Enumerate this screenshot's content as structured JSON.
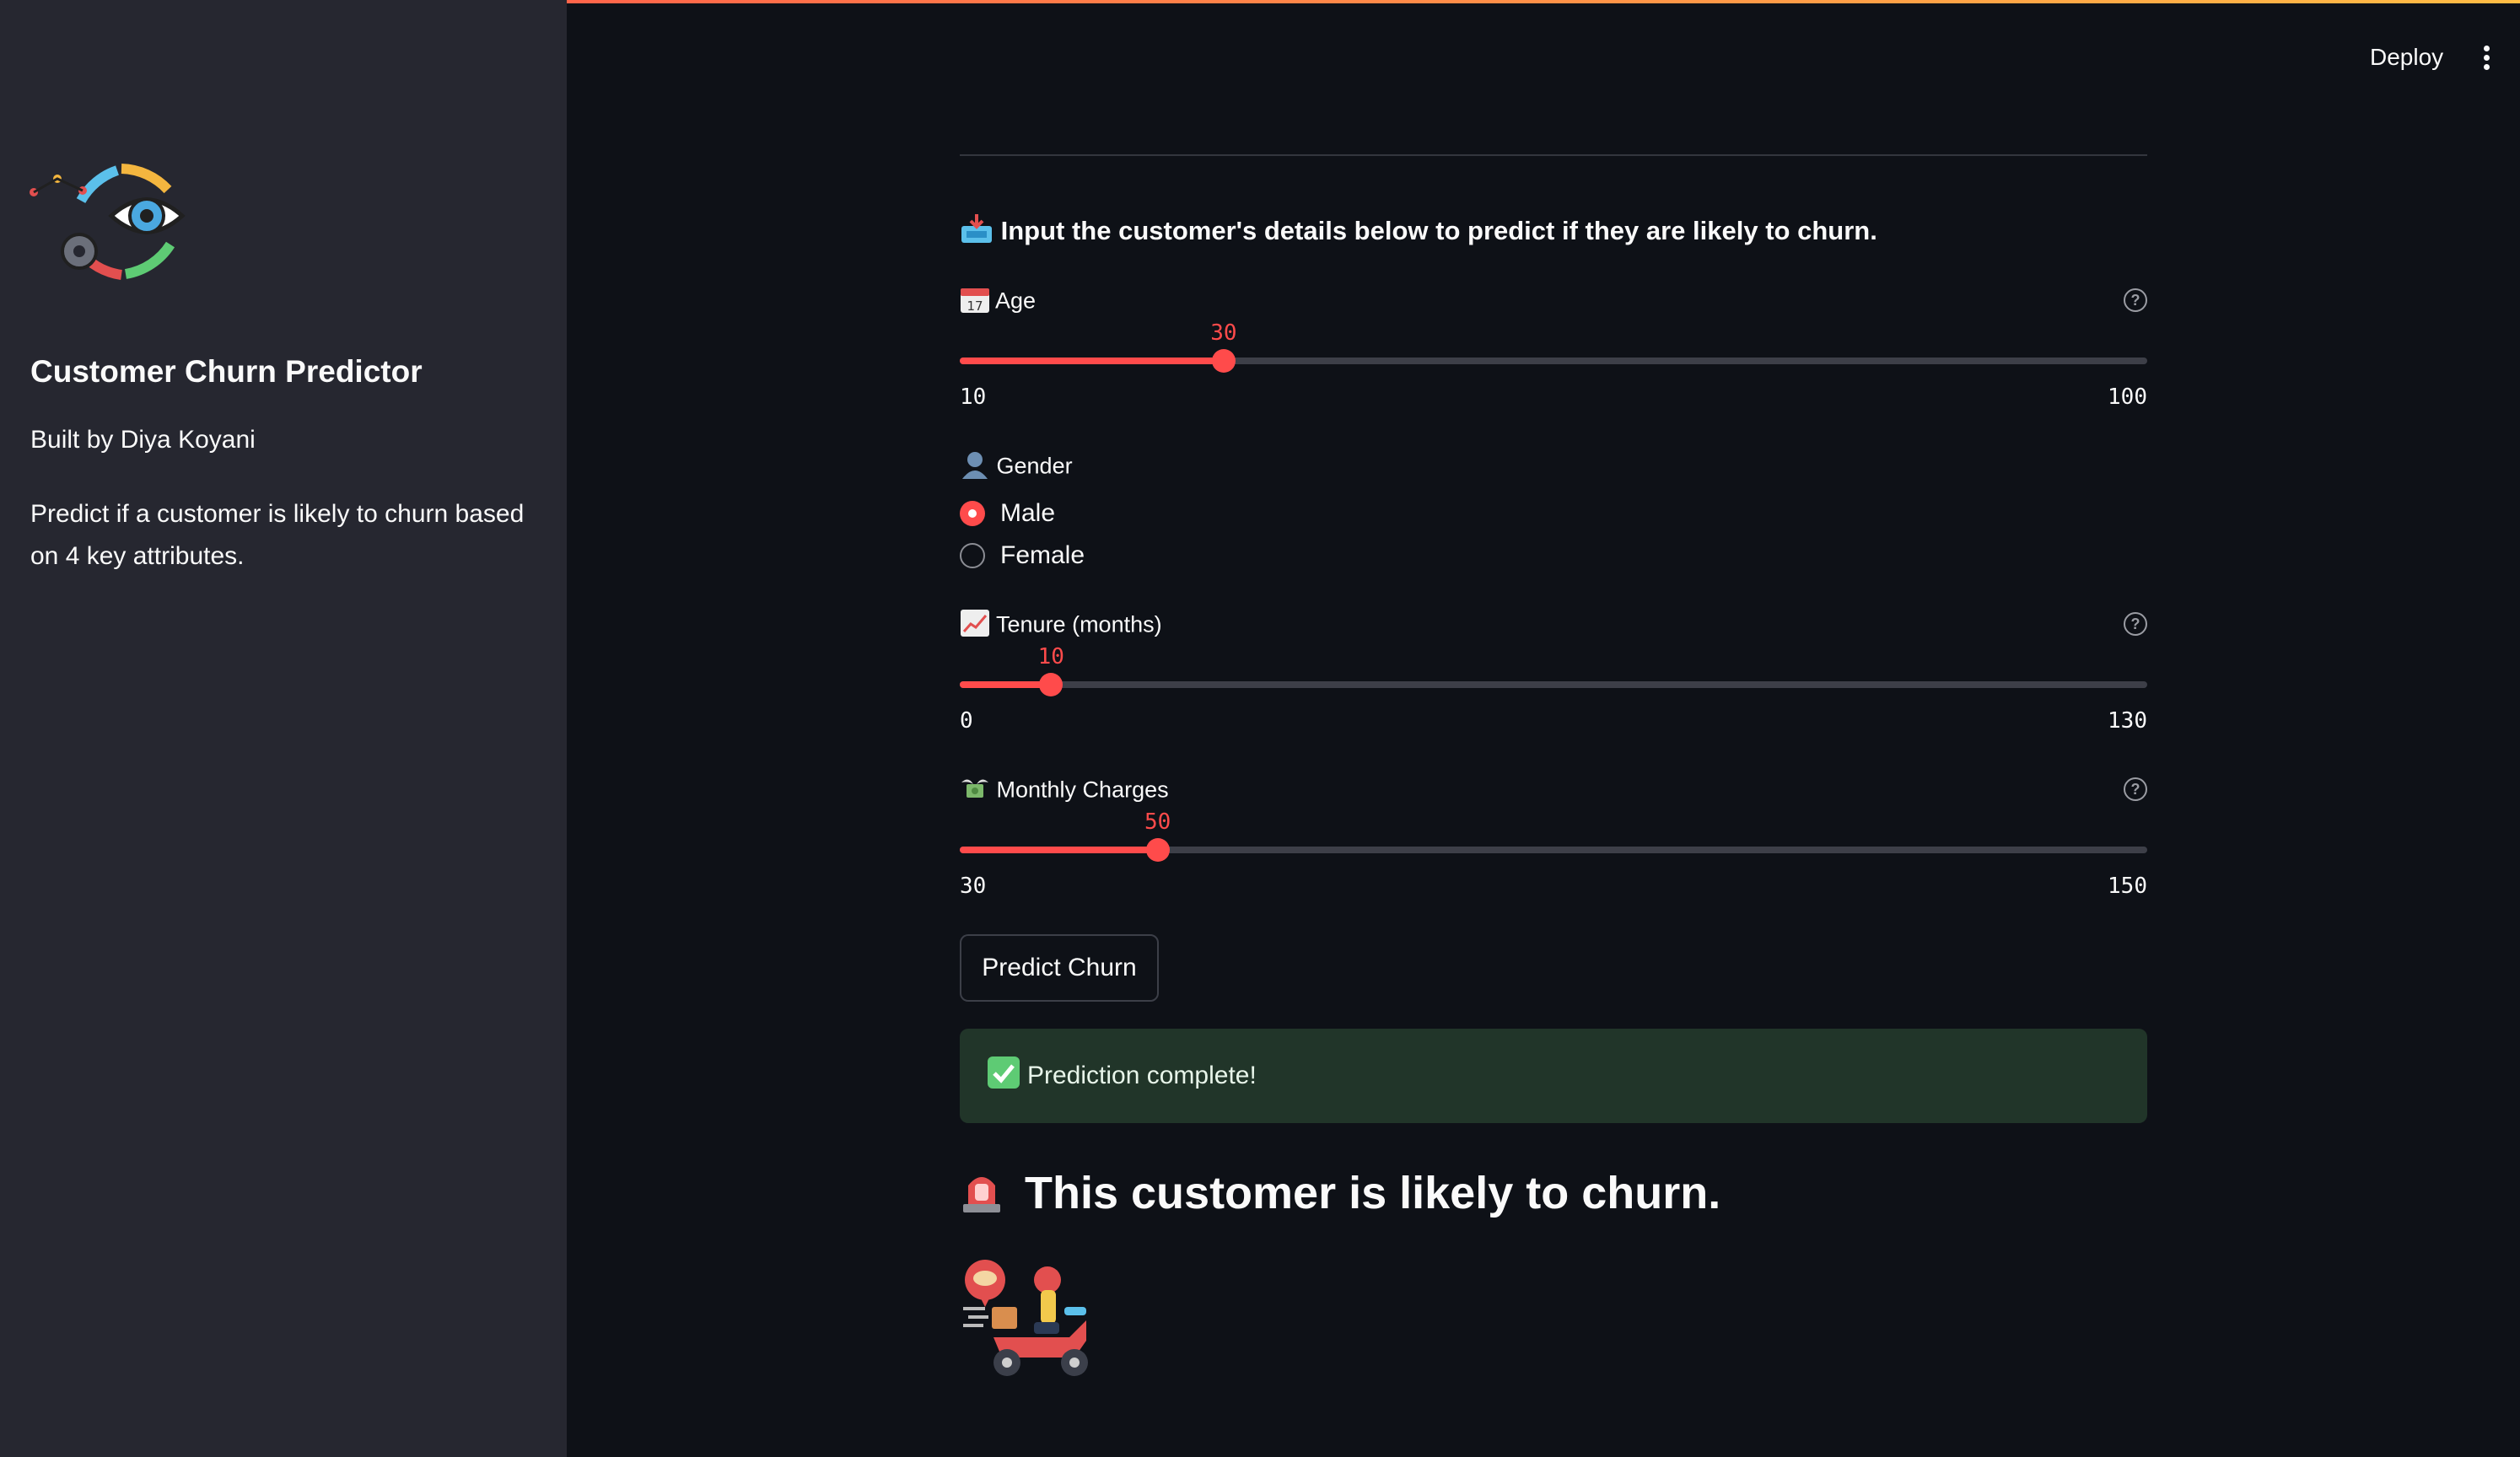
{
  "header": {
    "deploy_label": "Deploy",
    "menu_icon": "kebab-menu-icon"
  },
  "sidebar": {
    "title": "Customer Churn Predictor",
    "author": "Built by Diya Koyani",
    "description": "Predict if a customer is likely to churn based on 4 key attributes.",
    "logo_icon": "eye-gear-cycle-icon"
  },
  "main": {
    "intro": "Input the customer's details below to predict if they are likely to churn.",
    "intro_icon": "inbox-tray-icon",
    "age": {
      "label": "Age",
      "icon": "calendar-icon",
      "value": "30",
      "min": "10",
      "max": "100"
    },
    "gender": {
      "label": "Gender",
      "icon": "bust-silhouette-icon",
      "options": [
        "Male",
        "Female"
      ],
      "selected": "Male"
    },
    "tenure": {
      "label": "Tenure (months)",
      "icon": "chart-increasing-icon",
      "value": "10",
      "min": "0",
      "max": "130"
    },
    "charges": {
      "label": "Monthly Charges",
      "icon": "money-with-wings-icon",
      "value": "50",
      "min": "30",
      "max": "150"
    },
    "predict_button": "Predict Churn",
    "success_message": "Prediction complete!",
    "success_icon": "check-mark-button-icon",
    "result": "This customer is likely to churn.",
    "result_icon": "police-light-icon",
    "result_image_icon": "delivery-scooter-icon"
  },
  "colors": {
    "accent": "#ff4b4b",
    "background": "#0e1117",
    "sidebar": "#262730",
    "success_bg": "#213529"
  }
}
